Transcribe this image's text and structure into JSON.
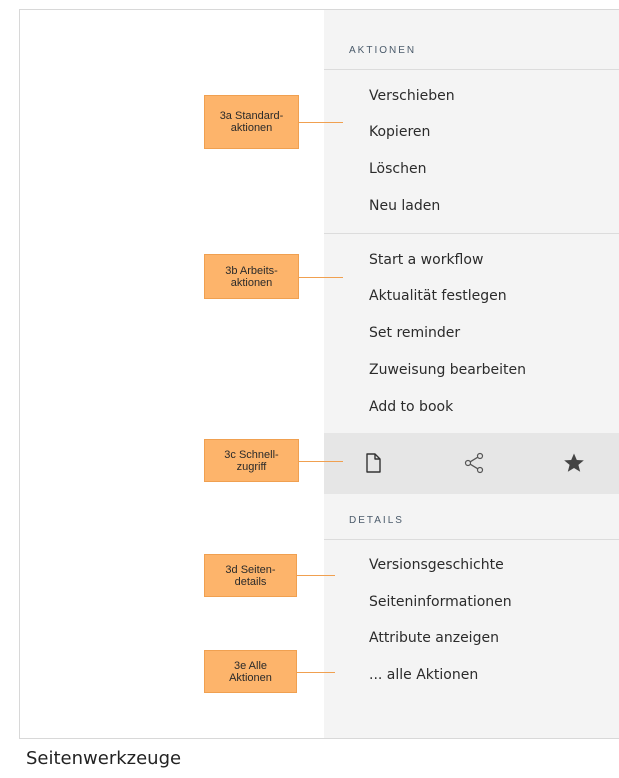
{
  "actions": {
    "heading": "AKTIONEN",
    "standard": [
      "Verschieben",
      "Kopieren",
      "Löschen",
      "Neu laden"
    ],
    "work": [
      "Start a workflow",
      "Aktualität festlegen",
      "Set reminder",
      "Zuweisung bearbeiten",
      "Add to book"
    ]
  },
  "quick_access": {
    "icons": [
      "page-icon",
      "share-icon",
      "star-icon"
    ]
  },
  "details": {
    "heading": "DETAILS",
    "items": [
      "Versionsgeschichte",
      "Seiteninformationen",
      "Attribute anzeigen",
      "... alle Aktionen"
    ]
  },
  "callouts": {
    "a": {
      "line1": "3a Standard-",
      "line2": "aktionen"
    },
    "b": {
      "line1": "3b Arbeits-",
      "line2": "aktionen"
    },
    "c": {
      "line1": "3c Schnell-",
      "line2": "zugriff"
    },
    "d": {
      "line1": "3d  Seiten-",
      "line2": "details"
    },
    "e": {
      "line1": "3e Alle",
      "line2": "Aktionen"
    }
  },
  "caption": "Seitenwerkzeuge",
  "colors": {
    "callout": "#fdb46b",
    "panel": "#f4f4f4",
    "quick_bar": "#e6e6e6"
  }
}
